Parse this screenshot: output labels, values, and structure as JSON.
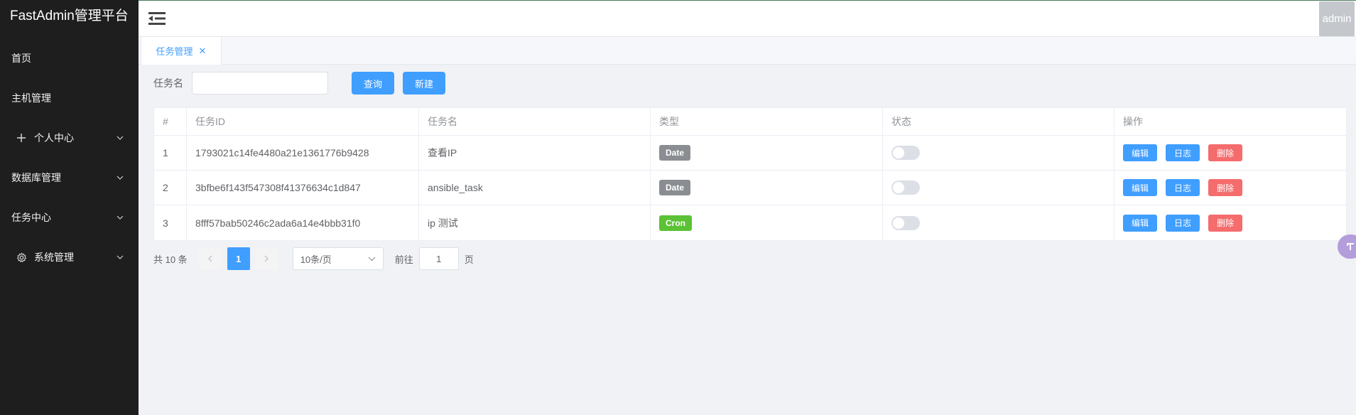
{
  "sidebar": {
    "brand": "FastAdmin管理平台",
    "items": [
      {
        "label": "首页",
        "icon": "",
        "has_children": false
      },
      {
        "label": "主机管理",
        "icon": "",
        "has_children": false
      },
      {
        "label": "个人中心",
        "icon": "plus-icon",
        "has_children": true
      },
      {
        "label": "数据库管理",
        "icon": "",
        "has_children": true
      },
      {
        "label": "任务中心",
        "icon": "",
        "has_children": true
      },
      {
        "label": "系统管理",
        "icon": "gear-icon",
        "has_children": true
      }
    ]
  },
  "header": {
    "avatar_label": "admin"
  },
  "tabs": [
    {
      "label": "任务管理",
      "active": true
    }
  ],
  "search": {
    "label": "任务名",
    "value": "",
    "placeholder": "",
    "query_label": "查询",
    "new_label": "新建"
  },
  "table": {
    "headers": [
      "#",
      "任务ID",
      "任务名",
      "类型",
      "状态",
      "操作"
    ],
    "rows": [
      {
        "index": "1",
        "id": "1793021c14fe4480a21e1361776b9428",
        "name": "查看IP",
        "type": "Date",
        "enabled": false
      },
      {
        "index": "2",
        "id": "3bfbe6f143f547308f41376634c1d847",
        "name": "ansible_task",
        "type": "Date",
        "enabled": false
      },
      {
        "index": "3",
        "id": "8fff57bab50246c2ada6a14e4bbb31f0",
        "name": "ip 测试",
        "type": "Cron",
        "enabled": false
      }
    ],
    "actions": {
      "edit": "编辑",
      "log": "日志",
      "delete": "删除"
    }
  },
  "pagination": {
    "total_text": "共 10 条",
    "current_page": "1",
    "page_size": "10条/页",
    "goto_label": "前往",
    "goto_value": "1",
    "page_suffix": "页"
  },
  "colors": {
    "sidebar_bg": "#1e1e1e",
    "primary": "#409eff",
    "danger": "#f56c6c",
    "date_badge": "#8a8d92",
    "cron_badge": "#5bc235"
  }
}
